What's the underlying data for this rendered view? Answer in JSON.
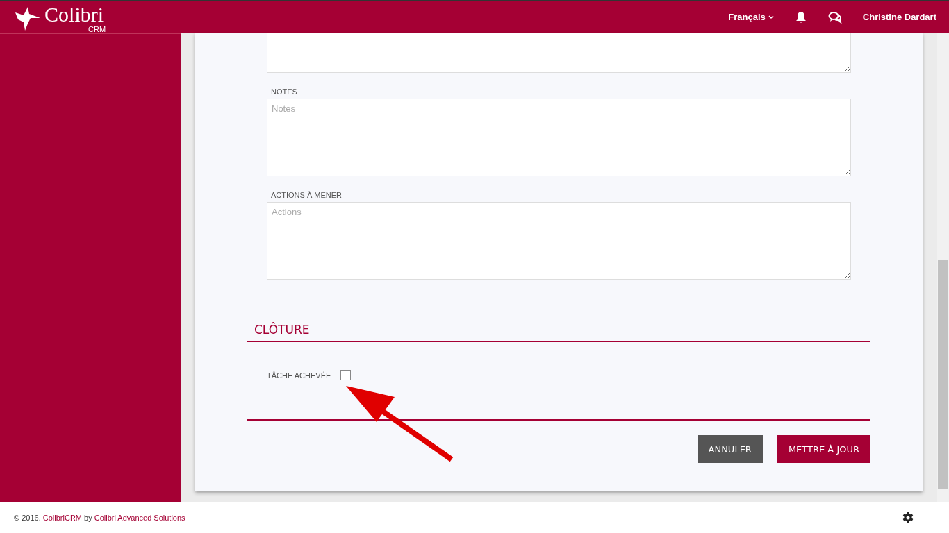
{
  "header": {
    "logo": {
      "name": "Colibri",
      "sub": "CRM"
    },
    "language": "Français",
    "user": "Christine Dardart"
  },
  "form": {
    "fields": [
      {
        "label": "NOTES",
        "placeholder": "Notes"
      },
      {
        "label": "ACTIONS À MENER",
        "placeholder": "Actions"
      }
    ],
    "section": {
      "title": "CLÔTURE",
      "checkbox": {
        "label": "TÂCHE ACHEVÉE",
        "checked": false
      }
    },
    "buttons": [
      {
        "label": "ANNULER",
        "kind": "secondary"
      },
      {
        "label": "METTRE À JOUR",
        "kind": "primary"
      }
    ]
  },
  "footer": {
    "prefix": "© 2016.",
    "product": "ColibriCRM",
    "by": "by",
    "company": "Colibri Advanced Solutions"
  }
}
